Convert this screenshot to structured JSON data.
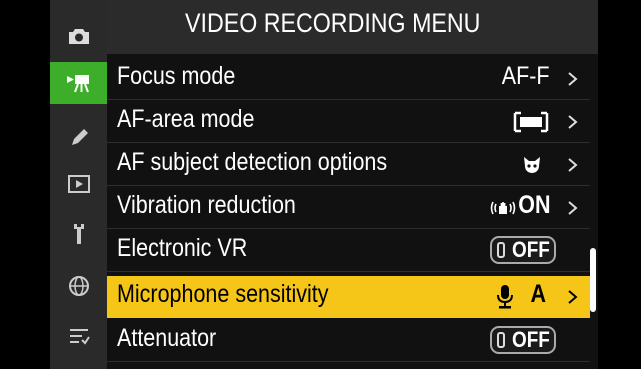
{
  "title": "VIDEO RECORDING MENU",
  "sidebar": {
    "items": [
      {
        "name": "camera-icon",
        "active": false
      },
      {
        "name": "video-camera-icon",
        "active": true
      },
      {
        "name": "pencil-icon",
        "active": false
      },
      {
        "name": "playback-icon",
        "active": false
      },
      {
        "name": "wrench-icon",
        "active": false
      },
      {
        "name": "network-icon",
        "active": false
      },
      {
        "name": "my-menu-icon",
        "active": false
      }
    ]
  },
  "menu": {
    "rows": [
      {
        "label": "Focus mode",
        "value": "AF-F",
        "kind": "text"
      },
      {
        "label": "AF-area mode",
        "value": "",
        "kind": "icon",
        "icon": "wide-area-icon"
      },
      {
        "label": "AF subject detection options",
        "value": "",
        "kind": "icon",
        "icon": "animal-detect-icon"
      },
      {
        "label": "Vibration reduction",
        "value": "ON",
        "kind": "vr"
      },
      {
        "label": "Electronic VR",
        "value": "OFF",
        "kind": "toggle"
      },
      {
        "label": "Microphone sensitivity",
        "value": "A",
        "kind": "mic",
        "selected": true
      },
      {
        "label": "Attenuator",
        "value": "OFF",
        "kind": "toggle"
      }
    ]
  },
  "colors": {
    "active_tab": "#3cae29",
    "selected_row": "#f5c518"
  }
}
